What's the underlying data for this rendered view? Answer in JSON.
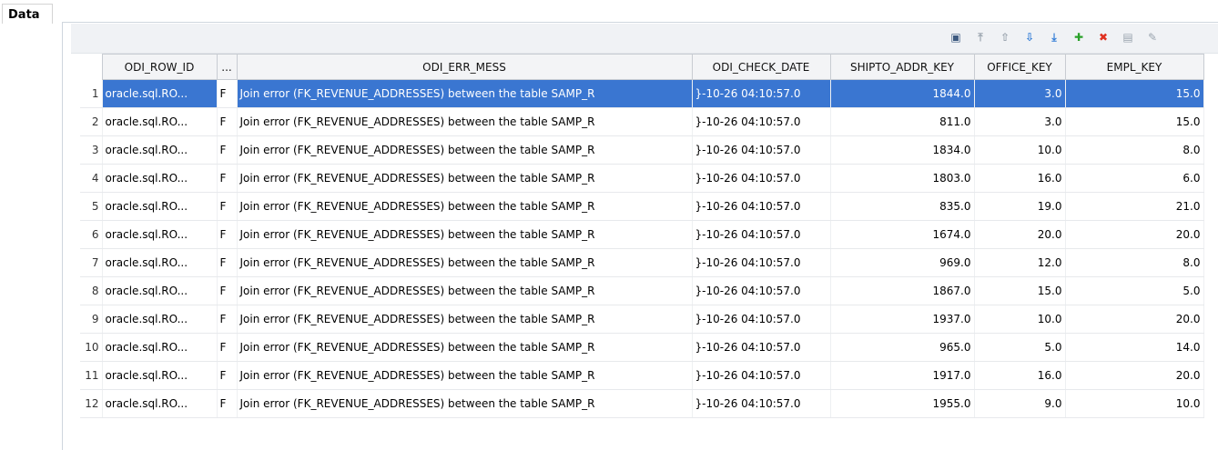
{
  "panel": {
    "title": "Data"
  },
  "toolbar": {
    "buttons": [
      {
        "name": "view-icon",
        "glyph": "▣",
        "color": "#3d5a80"
      },
      {
        "name": "move-top-icon",
        "glyph": "⤒",
        "color": "#9aa4ae"
      },
      {
        "name": "move-up-icon",
        "glyph": "⇧",
        "color": "#9aa4ae"
      },
      {
        "name": "move-down-icon",
        "glyph": "⇩",
        "color": "#2f7bd6"
      },
      {
        "name": "move-bottom-icon",
        "glyph": "⤓",
        "color": "#2f7bd6"
      },
      {
        "name": "add-row-icon",
        "glyph": "✚",
        "color": "#2aa12a"
      },
      {
        "name": "delete-row-icon",
        "glyph": "✖",
        "color": "#e03020"
      },
      {
        "name": "save-icon",
        "glyph": "▤",
        "color": "#9aa4ae"
      },
      {
        "name": "edit-icon",
        "glyph": "✎",
        "color": "#9aa4ae"
      }
    ]
  },
  "table": {
    "columns": [
      "ODI_ROW_ID",
      "...",
      "ODI_ERR_MESS",
      "ODI_CHECK_DATE",
      "SHIPTO_ADDR_KEY",
      "OFFICE_KEY",
      "EMPL_KEY"
    ],
    "selected_row": 0,
    "rows": [
      {
        "n": "1",
        "id": "oracle.sql.RO...",
        "flag": "F",
        "mess": "Join error (FK_REVENUE_ADDRESSES) between the table SAMP_R",
        "date": "}-10-26 04:10:57.0",
        "ship": "1844.0",
        "office": "3.0",
        "empl": "15.0"
      },
      {
        "n": "2",
        "id": "oracle.sql.RO...",
        "flag": "F",
        "mess": "Join error (FK_REVENUE_ADDRESSES) between the table SAMP_R",
        "date": "}-10-26 04:10:57.0",
        "ship": "811.0",
        "office": "3.0",
        "empl": "15.0"
      },
      {
        "n": "3",
        "id": "oracle.sql.RO...",
        "flag": "F",
        "mess": "Join error (FK_REVENUE_ADDRESSES) between the table SAMP_R",
        "date": "}-10-26 04:10:57.0",
        "ship": "1834.0",
        "office": "10.0",
        "empl": "8.0"
      },
      {
        "n": "4",
        "id": "oracle.sql.RO...",
        "flag": "F",
        "mess": "Join error (FK_REVENUE_ADDRESSES) between the table SAMP_R",
        "date": "}-10-26 04:10:57.0",
        "ship": "1803.0",
        "office": "16.0",
        "empl": "6.0"
      },
      {
        "n": "5",
        "id": "oracle.sql.RO...",
        "flag": "F",
        "mess": "Join error (FK_REVENUE_ADDRESSES) between the table SAMP_R",
        "date": "}-10-26 04:10:57.0",
        "ship": "835.0",
        "office": "19.0",
        "empl": "21.0"
      },
      {
        "n": "6",
        "id": "oracle.sql.RO...",
        "flag": "F",
        "mess": "Join error (FK_REVENUE_ADDRESSES) between the table SAMP_R",
        "date": "}-10-26 04:10:57.0",
        "ship": "1674.0",
        "office": "20.0",
        "empl": "20.0"
      },
      {
        "n": "7",
        "id": "oracle.sql.RO...",
        "flag": "F",
        "mess": "Join error (FK_REVENUE_ADDRESSES) between the table SAMP_R",
        "date": "}-10-26 04:10:57.0",
        "ship": "969.0",
        "office": "12.0",
        "empl": "8.0"
      },
      {
        "n": "8",
        "id": "oracle.sql.RO...",
        "flag": "F",
        "mess": "Join error (FK_REVENUE_ADDRESSES) between the table SAMP_R",
        "date": "}-10-26 04:10:57.0",
        "ship": "1867.0",
        "office": "15.0",
        "empl": "5.0"
      },
      {
        "n": "9",
        "id": "oracle.sql.RO...",
        "flag": "F",
        "mess": "Join error (FK_REVENUE_ADDRESSES) between the table SAMP_R",
        "date": "}-10-26 04:10:57.0",
        "ship": "1937.0",
        "office": "10.0",
        "empl": "20.0"
      },
      {
        "n": "10",
        "id": "oracle.sql.RO...",
        "flag": "F",
        "mess": "Join error (FK_REVENUE_ADDRESSES) between the table SAMP_R",
        "date": "}-10-26 04:10:57.0",
        "ship": "965.0",
        "office": "5.0",
        "empl": "14.0"
      },
      {
        "n": "11",
        "id": "oracle.sql.RO...",
        "flag": "F",
        "mess": "Join error (FK_REVENUE_ADDRESSES) between the table SAMP_R",
        "date": "}-10-26 04:10:57.0",
        "ship": "1917.0",
        "office": "16.0",
        "empl": "20.0"
      },
      {
        "n": "12",
        "id": "oracle.sql.RO...",
        "flag": "F",
        "mess": "Join error (FK_REVENUE_ADDRESSES) between the table SAMP_R",
        "date": "}-10-26 04:10:57.0",
        "ship": "1955.0",
        "office": "9.0",
        "empl": "10.0"
      }
    ]
  }
}
